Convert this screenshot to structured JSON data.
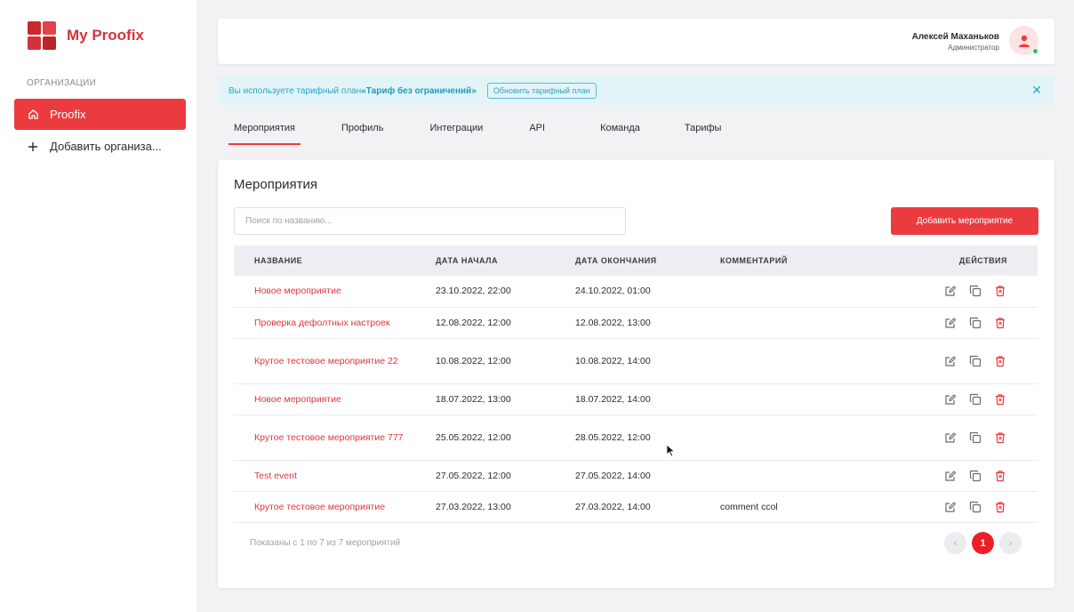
{
  "sidebar": {
    "brand": "My Proofix",
    "section_label": "ОРГАНИЗАЦИИ",
    "items": [
      {
        "label": "Proofix",
        "icon": "home-icon"
      },
      {
        "label": "Добавить организа...",
        "icon": "plus-icon"
      }
    ]
  },
  "header": {
    "user_name": "Алексей Маханьков",
    "user_role": "Администратор"
  },
  "alert": {
    "text": "Вы используете тарифный план ",
    "plan": "«Тариф без ограничений»",
    "button": "Обновить тарифный план"
  },
  "tabs": [
    "Мероприятия",
    "Профиль",
    "Интеграции",
    "API",
    "Команда",
    "Тарифы"
  ],
  "events": {
    "title": "Мероприятия",
    "search_placeholder": "Поиск по названию...",
    "add_button": "Добавить мероприятие",
    "columns": [
      "НАЗВАНИЕ",
      "ДАТА НАЧАЛА",
      "ДАТА ОКОНЧАНИЯ",
      "КОММЕНТАРИЙ",
      "ДЕЙСТВИЯ"
    ],
    "rows": [
      {
        "name": "Новое мероприятие",
        "start": "23.10.2022, 22:00",
        "end": "24.10.2022, 01:00",
        "comment": ""
      },
      {
        "name": "Проверка дефолтных настроек",
        "start": "12.08.2022, 12:00",
        "end": "12.08.2022, 13:00",
        "comment": ""
      },
      {
        "name": "Крутое тестовое мероприятие 22",
        "start": "10.08.2022, 12:00",
        "end": "10.08.2022, 14:00",
        "comment": ""
      },
      {
        "name": "Новое мероприятие",
        "start": "18.07.2022, 13:00",
        "end": "18.07.2022, 14:00",
        "comment": ""
      },
      {
        "name": "Крутое тестовое мероприятие 777",
        "start": "25.05.2022, 12:00",
        "end": "28.05.2022, 12:00",
        "comment": ""
      },
      {
        "name": "Test event",
        "start": "27.05.2022, 12:00",
        "end": "27.05.2022, 14:00",
        "comment": ""
      },
      {
        "name": "Крутое тестовое мероприятие",
        "start": "27.03.2022, 13:00",
        "end": "27.03.2022, 14:00",
        "comment": "comment ccol"
      }
    ],
    "footer": "Показаны с 1 по 7 из 7 мероприятий",
    "pagination": {
      "prev": "‹",
      "current": "1",
      "next": "›"
    }
  },
  "colors": {
    "accent": "#ec3b3f",
    "info": "#2aa6c7",
    "online": "#2fbf5f"
  }
}
